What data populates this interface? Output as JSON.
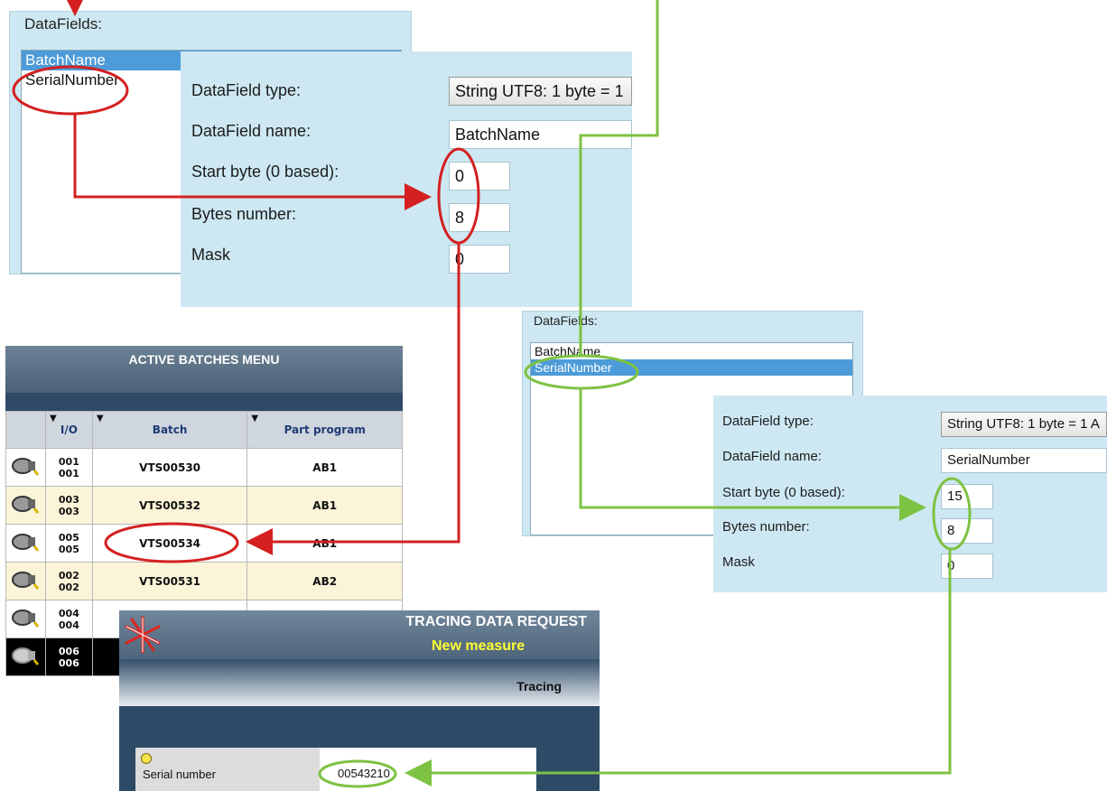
{
  "panel1": {
    "legend": "DataFields:",
    "list_items": [
      "BatchName",
      "SerialNumber"
    ],
    "selected_index": 0,
    "labels": {
      "type": "DataField type:",
      "name": "DataField name:",
      "start": "Start byte (0 based):",
      "bytes": "Bytes number:",
      "mask": "Mask"
    },
    "values": {
      "type": "String UTF8: 1 byte = 1",
      "name": "BatchName",
      "start": "0",
      "bytes": "8",
      "mask": "0"
    }
  },
  "panel2": {
    "legend": "DataFields:",
    "list_items": [
      "BatchName",
      "SerialNumber"
    ],
    "selected_index": 1,
    "labels": {
      "type": "DataField type:",
      "name": "DataField name:",
      "start": "Start byte (0 based):",
      "bytes": "Bytes number:",
      "mask": "Mask"
    },
    "values": {
      "type": "String UTF8: 1 byte = 1 A",
      "name": "SerialNumber",
      "start": "15",
      "bytes": "8",
      "mask": "0"
    }
  },
  "batches": {
    "title": "ACTIVE BATCHES MENU",
    "columns": [
      "I/O",
      "Batch",
      "Part program"
    ],
    "rows": [
      {
        "io_top": "001",
        "io_bottom": "001",
        "batch": "VTS00530",
        "program": "AB1"
      },
      {
        "io_top": "003",
        "io_bottom": "003",
        "batch": "VTS00532",
        "program": "AB1"
      },
      {
        "io_top": "005",
        "io_bottom": "005",
        "batch": "VTS00534",
        "program": "AB1"
      },
      {
        "io_top": "002",
        "io_bottom": "002",
        "batch": "VTS00531",
        "program": "AB2"
      },
      {
        "io_top": "004",
        "io_bottom": "004",
        "batch": "",
        "program": ""
      },
      {
        "io_top": "006",
        "io_bottom": "006",
        "batch": "",
        "program": ""
      }
    ]
  },
  "tracing": {
    "title": "TRACING DATA REQUEST",
    "subtitle": "New measure",
    "tab": "Tracing",
    "field_label": "Serial number",
    "field_value": "00543210"
  },
  "colors": {
    "red_annotation": "#d42020",
    "green_annotation": "#7dc242",
    "panel_bg": "#cde8f2",
    "selection": "#4d9bd8"
  }
}
